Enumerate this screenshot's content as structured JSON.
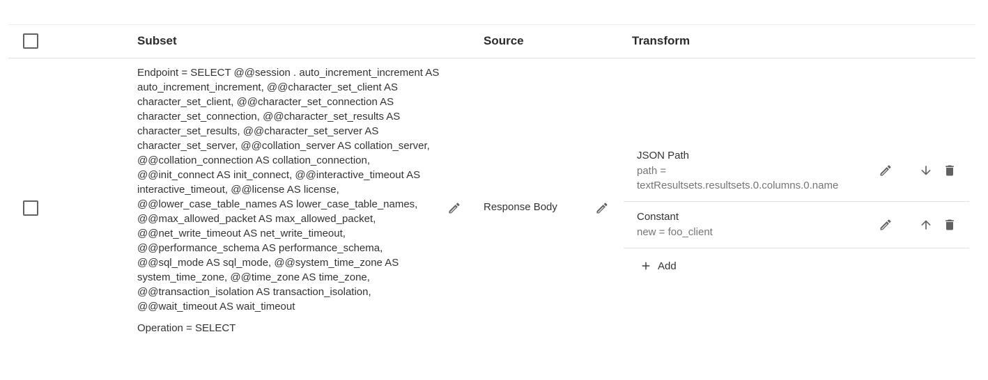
{
  "table": {
    "headers": {
      "subset": "Subset",
      "source": "Source",
      "transform": "Transform"
    },
    "rows": [
      {
        "subset": {
          "endpoint": "Endpoint = SELECT @@session . auto_increment_increment AS auto_increment_increment, @@character_set_client AS character_set_client, @@character_set_connection AS character_set_connection, @@character_set_results AS character_set_results, @@character_set_server AS character_set_server, @@collation_server AS collation_server, @@collation_connection AS collation_connection, @@init_connect AS init_connect, @@interactive_timeout AS interactive_timeout, @@license AS license, @@lower_case_table_names AS lower_case_table_names, @@max_allowed_packet AS max_allowed_packet, @@net_write_timeout AS net_write_timeout, @@performance_schema AS performance_schema, @@sql_mode AS sql_mode, @@system_time_zone AS system_time_zone, @@time_zone AS time_zone, @@transaction_isolation AS transaction_isolation, @@wait_timeout AS wait_timeout",
          "operation": "Operation = SELECT"
        },
        "source": "Response Body",
        "transforms": [
          {
            "name": "JSON Path",
            "detail_line1": "path =",
            "detail_line2": "textResultsets.resultsets.0.columns.0.name",
            "move_icon": "arrow-down-icon"
          },
          {
            "name": "Constant",
            "detail_line1": "new = foo_client",
            "move_icon": "arrow-up-icon"
          }
        ],
        "add_label": "Add"
      }
    ]
  },
  "icons": [
    "checkbox-icon",
    "pencil-icon",
    "arrow-down-icon",
    "arrow-up-icon",
    "trash-icon",
    "plus-icon"
  ],
  "colors": {
    "text": "#333333",
    "muted": "#757575",
    "icon": "#616161",
    "divider": "#e0e0e0"
  }
}
